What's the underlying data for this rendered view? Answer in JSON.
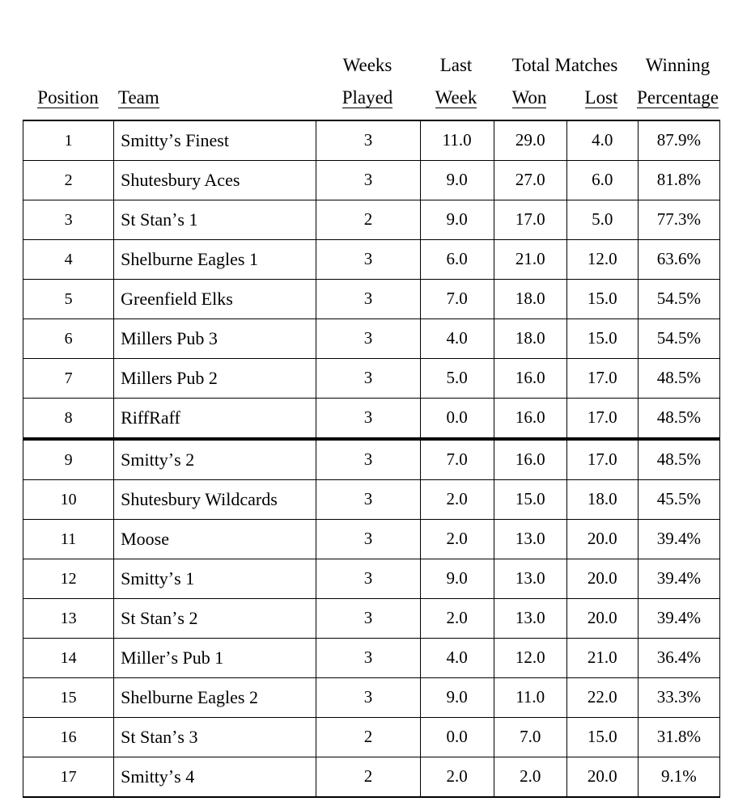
{
  "document": {
    "type": "league-standings-table",
    "background_color": "#ffffff",
    "text_color": "#000000"
  },
  "header": {
    "line1": {
      "position": "",
      "team": "",
      "weeks_played": "Weeks",
      "last_week": "Last",
      "total_matches": "Total Matches",
      "winning": "Winning"
    },
    "line2": {
      "position": "Position",
      "team": "Team",
      "weeks_played": "Played",
      "last_week": "Week",
      "won": "Won",
      "lost": "Lost",
      "percentage": "Percentage"
    }
  },
  "table": {
    "columns": [
      "Position",
      "Team",
      "Weeks Played",
      "Last Week",
      "Won",
      "Lost",
      "Winning Percentage"
    ],
    "divider_after_row": 8,
    "rows": [
      {
        "position": "1",
        "team": "Smittyʼs Finest",
        "weeks_played": "3",
        "last_week": "11.0",
        "won": "29.0",
        "lost": "4.0",
        "percentage": "87.9%"
      },
      {
        "position": "2",
        "team": "Shutesbury Aces",
        "weeks_played": "3",
        "last_week": "9.0",
        "won": "27.0",
        "lost": "6.0",
        "percentage": "81.8%"
      },
      {
        "position": "3",
        "team": "St Stanʼs 1",
        "weeks_played": "2",
        "last_week": "9.0",
        "won": "17.0",
        "lost": "5.0",
        "percentage": "77.3%"
      },
      {
        "position": "4",
        "team": "Shelburne Eagles 1",
        "weeks_played": "3",
        "last_week": "6.0",
        "won": "21.0",
        "lost": "12.0",
        "percentage": "63.6%"
      },
      {
        "position": "5",
        "team": "Greenfield Elks",
        "weeks_played": "3",
        "last_week": "7.0",
        "won": "18.0",
        "lost": "15.0",
        "percentage": "54.5%"
      },
      {
        "position": "6",
        "team": "Millers Pub 3",
        "weeks_played": "3",
        "last_week": "4.0",
        "won": "18.0",
        "lost": "15.0",
        "percentage": "54.5%"
      },
      {
        "position": "7",
        "team": "Millers Pub 2",
        "weeks_played": "3",
        "last_week": "5.0",
        "won": "16.0",
        "lost": "17.0",
        "percentage": "48.5%"
      },
      {
        "position": "8",
        "team": "RiffRaff",
        "weeks_played": "3",
        "last_week": "0.0",
        "won": "16.0",
        "lost": "17.0",
        "percentage": "48.5%"
      },
      {
        "position": "9",
        "team": "Smittyʼs 2",
        "weeks_played": "3",
        "last_week": "7.0",
        "won": "16.0",
        "lost": "17.0",
        "percentage": "48.5%"
      },
      {
        "position": "10",
        "team": "Shutesbury Wildcards",
        "weeks_played": "3",
        "last_week": "2.0",
        "won": "15.0",
        "lost": "18.0",
        "percentage": "45.5%"
      },
      {
        "position": "11",
        "team": "Moose",
        "weeks_played": "3",
        "last_week": "2.0",
        "won": "13.0",
        "lost": "20.0",
        "percentage": "39.4%"
      },
      {
        "position": "12",
        "team": "Smittyʼs 1",
        "weeks_played": "3",
        "last_week": "9.0",
        "won": "13.0",
        "lost": "20.0",
        "percentage": "39.4%"
      },
      {
        "position": "13",
        "team": "St Stanʼs 2",
        "weeks_played": "3",
        "last_week": "2.0",
        "won": "13.0",
        "lost": "20.0",
        "percentage": "39.4%"
      },
      {
        "position": "14",
        "team": "Millerʼs Pub 1",
        "weeks_played": "3",
        "last_week": "4.0",
        "won": "12.0",
        "lost": "21.0",
        "percentage": "36.4%"
      },
      {
        "position": "15",
        "team": "Shelburne Eagles 2",
        "weeks_played": "3",
        "last_week": "9.0",
        "won": "11.0",
        "lost": "22.0",
        "percentage": "33.3%"
      },
      {
        "position": "16",
        "team": "St Stanʼs 3",
        "weeks_played": "2",
        "last_week": "0.0",
        "won": "7.0",
        "lost": "15.0",
        "percentage": "31.8%"
      },
      {
        "position": "17",
        "team": "Smittyʼs 4",
        "weeks_played": "2",
        "last_week": "2.0",
        "won": "2.0",
        "lost": "20.0",
        "percentage": "9.1%"
      }
    ]
  }
}
